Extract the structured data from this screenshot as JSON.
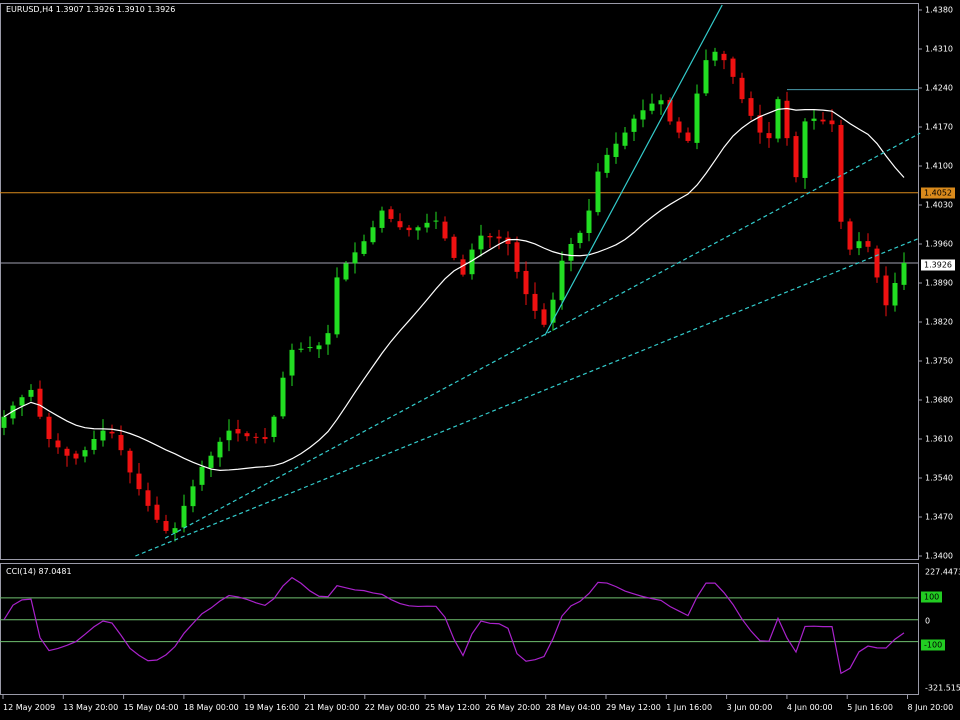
{
  "header": {
    "title": "EURUSD,H4 1.3907 1.3926 1.3910 1.3926"
  },
  "cci": {
    "title": "CCI(14) 87.0481",
    "max_label": "227.4473",
    "min_label": "-321.5151",
    "levels": [
      "100",
      "0",
      "-100"
    ],
    "level_values": [
      100,
      0,
      -100
    ],
    "range": [
      -321.5,
      227.4
    ],
    "period": 14
  },
  "price_axis": {
    "labels": [
      "1.4380",
      "1.4310",
      "1.4240",
      "1.4170",
      "1.4100",
      "1.4030",
      "1.3960",
      "1.3890",
      "1.3820",
      "1.3750",
      "1.3680",
      "1.3610",
      "1.3540",
      "1.3470",
      "1.3400"
    ],
    "range": [
      1.34,
      1.438
    ]
  },
  "markers": {
    "orange_line": "1.4052",
    "current_price": "1.3926",
    "orange_value": 1.4052,
    "current_value": 1.3926,
    "short_line_value": 1.4237
  },
  "time_axis": [
    "12 May 2009",
    "13 May 20:00",
    "15 May 04:00",
    "18 May 00:00",
    "19 May 16:00",
    "21 May 00:00",
    "22 May 00:00",
    "25 May 12:00",
    "26 May 20:00",
    "28 May 04:00",
    "29 May 12:00",
    "1 Jun 16:00",
    "3 Jun 00:00",
    "4 Jun 00:00",
    "5 Jun 16:00",
    "8 Jun 20:00"
  ],
  "colors": {
    "bull": "#22dd22",
    "bear": "#ee1111",
    "ma": "#ffffff",
    "trend": "#33cccc",
    "orange": "#d98a1c",
    "cci": "#aa22cc",
    "level": "#6fbf6f",
    "grid": "#9a9aa8"
  },
  "chart_data": {
    "type": "candlestick",
    "symbol": "EURUSD",
    "timeframe": "H4",
    "ylim": [
      1.34,
      1.438
    ],
    "ma_period": 20,
    "closes": [
      1.365,
      1.367,
      1.3685,
      1.3698,
      1.365,
      1.361,
      1.3595,
      1.358,
      1.3575,
      1.359,
      1.361,
      1.3625,
      1.362,
      1.359,
      1.355,
      1.352,
      1.349,
      1.3465,
      1.3445,
      1.345,
      1.349,
      1.3525,
      1.356,
      1.358,
      1.3605,
      1.3625,
      1.362,
      1.3615,
      1.3612,
      1.361,
      1.365,
      1.372,
      1.377,
      1.3772,
      1.3775,
      1.3778,
      1.38,
      1.39,
      1.3925,
      1.3945,
      1.3965,
      1.399,
      1.402,
      1.4005,
      1.399,
      1.3985,
      1.399,
      1.3998,
      1.4002,
      1.397,
      1.3935,
      1.3905,
      1.395,
      1.3975,
      1.3972,
      1.397,
      1.396,
      1.391,
      1.387,
      1.384,
      1.3815,
      1.386,
      1.393,
      1.396,
      1.398,
      1.402,
      1.409,
      1.412,
      1.414,
      1.416,
      1.4185,
      1.42,
      1.4212,
      1.4218,
      1.418,
      1.416,
      1.4145,
      1.423,
      1.429,
      1.4305,
      1.429,
      1.426,
      1.422,
      1.419,
      1.416,
      1.415,
      1.422,
      1.415,
      1.408,
      1.418,
      1.4185,
      1.418,
      1.4175,
      1.4,
      1.395,
      1.3965,
      1.3955,
      1.39,
      1.385,
      1.389,
      1.3926
    ],
    "trendlines": [
      {
        "style": "dashed",
        "from": [
          14.6,
          1.34
        ],
        "to": [
          101.8,
          1.3971
        ]
      },
      {
        "style": "dashed",
        "from": [
          17.9,
          1.3432
        ],
        "to": [
          101.8,
          1.4159
        ]
      },
      {
        "style": "solid",
        "from": [
          60.1,
          1.3796
        ],
        "to": [
          79.8,
          1.4389
        ]
      }
    ]
  }
}
